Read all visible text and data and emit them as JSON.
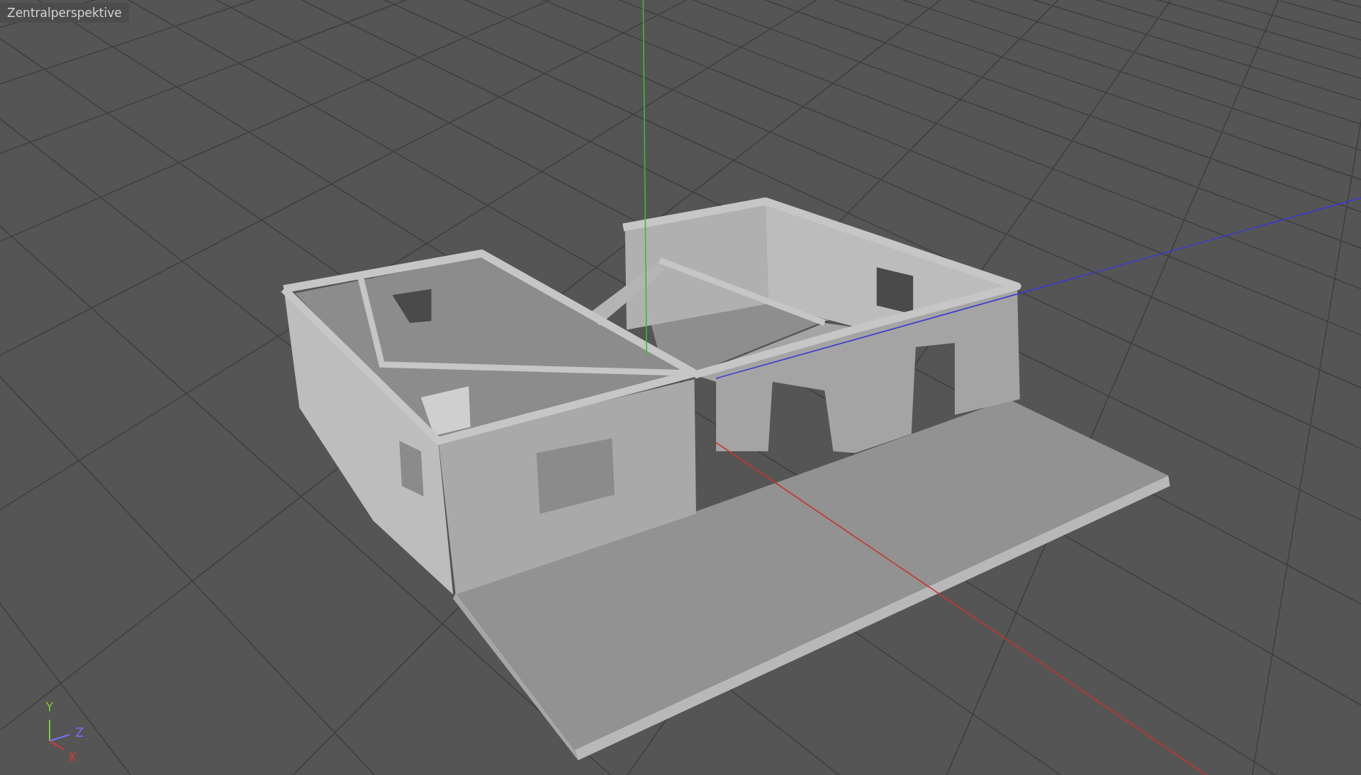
{
  "viewport": {
    "title": "Zentralperspektive",
    "axes": [
      {
        "label": "Y",
        "color": "#7cc83a"
      },
      {
        "label": "Z",
        "color": "#7a70ff"
      },
      {
        "label": "X",
        "color": "#e0382a"
      }
    ]
  }
}
